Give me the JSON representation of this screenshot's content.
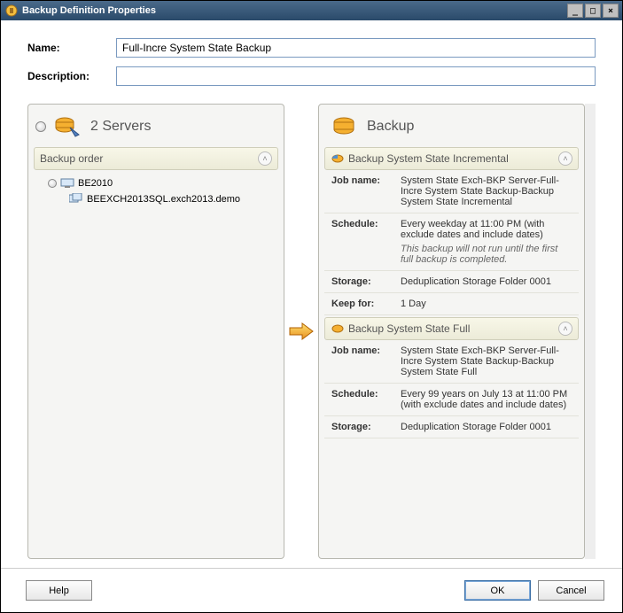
{
  "window": {
    "title": "Backup Definition Properties"
  },
  "fields": {
    "name_label": "Name:",
    "name_value": "Full-Incre System State Backup",
    "desc_label": "Description:",
    "desc_value": ""
  },
  "left_panel": {
    "title": "2 Servers",
    "order_header": "Backup order",
    "items": [
      {
        "label": "BE2010"
      },
      {
        "label": "BEEXCH2013SQL.exch2013.demo"
      }
    ]
  },
  "right_panel": {
    "title": "Backup",
    "sections": [
      {
        "header": "Backup System State Incremental",
        "rows": [
          {
            "label": "Job name:",
            "value": "System State Exch-BKP Server-Full-Incre System State Backup-Backup System State Incremental"
          },
          {
            "label": "Schedule:",
            "value": "Every weekday at 11:00 PM (with exclude dates and include dates)",
            "note": "This backup will not run until the first full backup is completed."
          },
          {
            "label": "Storage:",
            "value": "Deduplication Storage Folder 0001"
          },
          {
            "label": "Keep for:",
            "value": "1 Day"
          }
        ]
      },
      {
        "header": "Backup System State Full",
        "rows": [
          {
            "label": "Job name:",
            "value": "System State Exch-BKP Server-Full-Incre System State Backup-Backup System State Full"
          },
          {
            "label": "Schedule:",
            "value": "Every 99 years on July 13 at 11:00 PM (with exclude dates and include dates)"
          },
          {
            "label": "Storage:",
            "value": "Deduplication Storage Folder 0001"
          }
        ]
      }
    ]
  },
  "buttons": {
    "help": "Help",
    "ok": "OK",
    "cancel": "Cancel"
  }
}
